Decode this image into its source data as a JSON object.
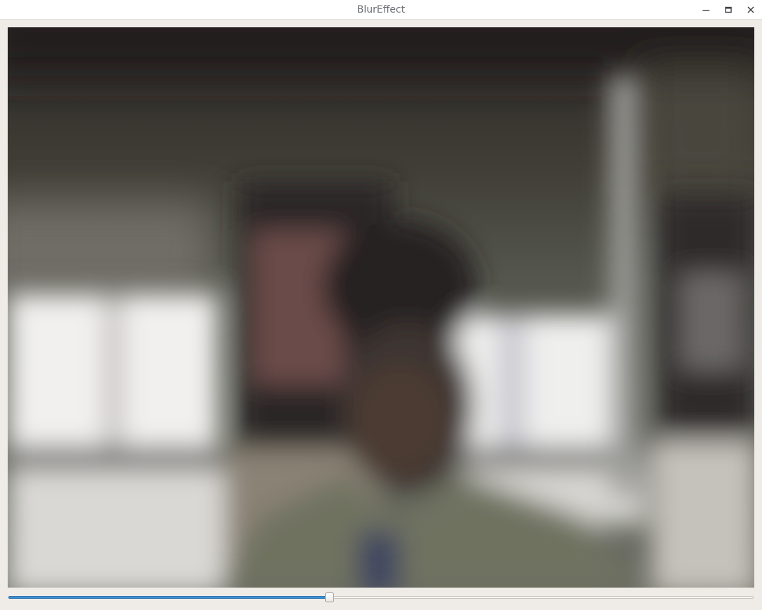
{
  "window": {
    "title": "BlurEffect",
    "controls": {
      "minimize_icon": "minimize-icon",
      "maximize_icon": "maximize-icon",
      "close_icon": "close-icon"
    }
  },
  "video": {
    "description_icon": "camera-frame",
    "blurred": true
  },
  "slider": {
    "value_fraction": 0.43,
    "accent_color": "#3d8fd1"
  }
}
